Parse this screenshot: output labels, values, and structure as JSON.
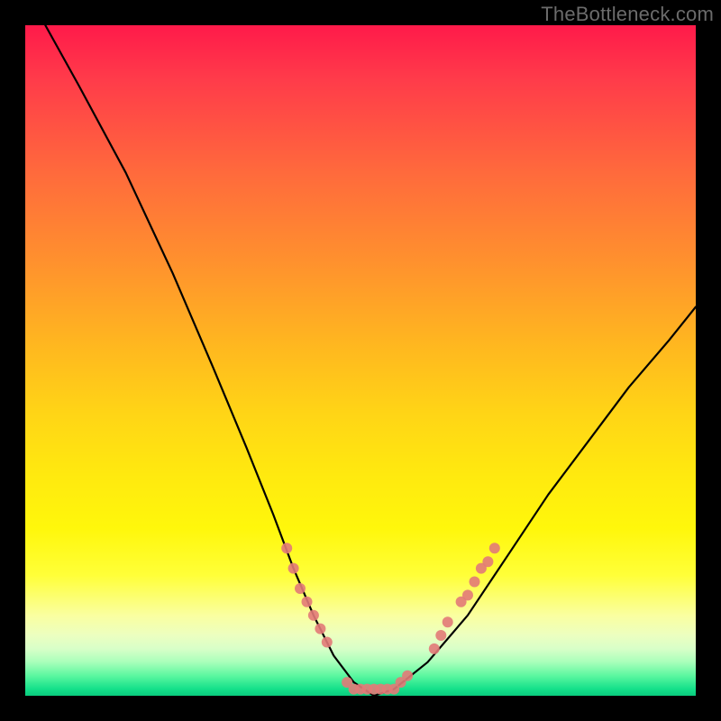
{
  "watermark": "TheBottleneck.com",
  "chart_data": {
    "type": "line",
    "title": "",
    "xlabel": "",
    "ylabel": "",
    "xlim": [
      0,
      100
    ],
    "ylim": [
      0,
      100
    ],
    "grid": false,
    "legend": false,
    "series": [
      {
        "name": "bottleneck-curve",
        "color": "#000000",
        "x": [
          3,
          8,
          15,
          22,
          28,
          33,
          37,
          40,
          43,
          46,
          49,
          52,
          55,
          60,
          66,
          72,
          78,
          84,
          90,
          96,
          100
        ],
        "values": [
          100,
          91,
          78,
          63,
          49,
          37,
          27,
          19,
          12,
          6,
          2,
          0,
          1,
          5,
          12,
          21,
          30,
          38,
          46,
          53,
          58
        ]
      }
    ],
    "markers": [
      {
        "name": "left-cluster",
        "shape": "circle",
        "color": "#e27a78",
        "points": [
          {
            "x": 39,
            "y": 22
          },
          {
            "x": 40,
            "y": 19
          },
          {
            "x": 41,
            "y": 16
          },
          {
            "x": 42,
            "y": 14
          },
          {
            "x": 43,
            "y": 12
          },
          {
            "x": 44,
            "y": 10
          },
          {
            "x": 45,
            "y": 8
          }
        ]
      },
      {
        "name": "bottom-cluster",
        "shape": "circle",
        "color": "#e27a78",
        "points": [
          {
            "x": 48,
            "y": 2
          },
          {
            "x": 49,
            "y": 1
          },
          {
            "x": 50,
            "y": 1
          },
          {
            "x": 51,
            "y": 1
          },
          {
            "x": 52,
            "y": 1
          },
          {
            "x": 53,
            "y": 1
          },
          {
            "x": 54,
            "y": 1
          },
          {
            "x": 55,
            "y": 1
          },
          {
            "x": 56,
            "y": 2
          },
          {
            "x": 57,
            "y": 3
          }
        ]
      },
      {
        "name": "right-cluster",
        "shape": "circle",
        "color": "#e27a78",
        "points": [
          {
            "x": 61,
            "y": 7
          },
          {
            "x": 62,
            "y": 9
          },
          {
            "x": 63,
            "y": 11
          },
          {
            "x": 65,
            "y": 14
          },
          {
            "x": 66,
            "y": 15
          },
          {
            "x": 67,
            "y": 17
          },
          {
            "x": 68,
            "y": 19
          },
          {
            "x": 69,
            "y": 20
          },
          {
            "x": 70,
            "y": 22
          }
        ]
      }
    ],
    "background_gradient": {
      "direction": "vertical",
      "stops": [
        {
          "pos": 0,
          "color": "#ff1a4a"
        },
        {
          "pos": 50,
          "color": "#ffd516"
        },
        {
          "pos": 90,
          "color": "#faffa0"
        },
        {
          "pos": 100,
          "color": "#0acb7e"
        }
      ]
    }
  }
}
